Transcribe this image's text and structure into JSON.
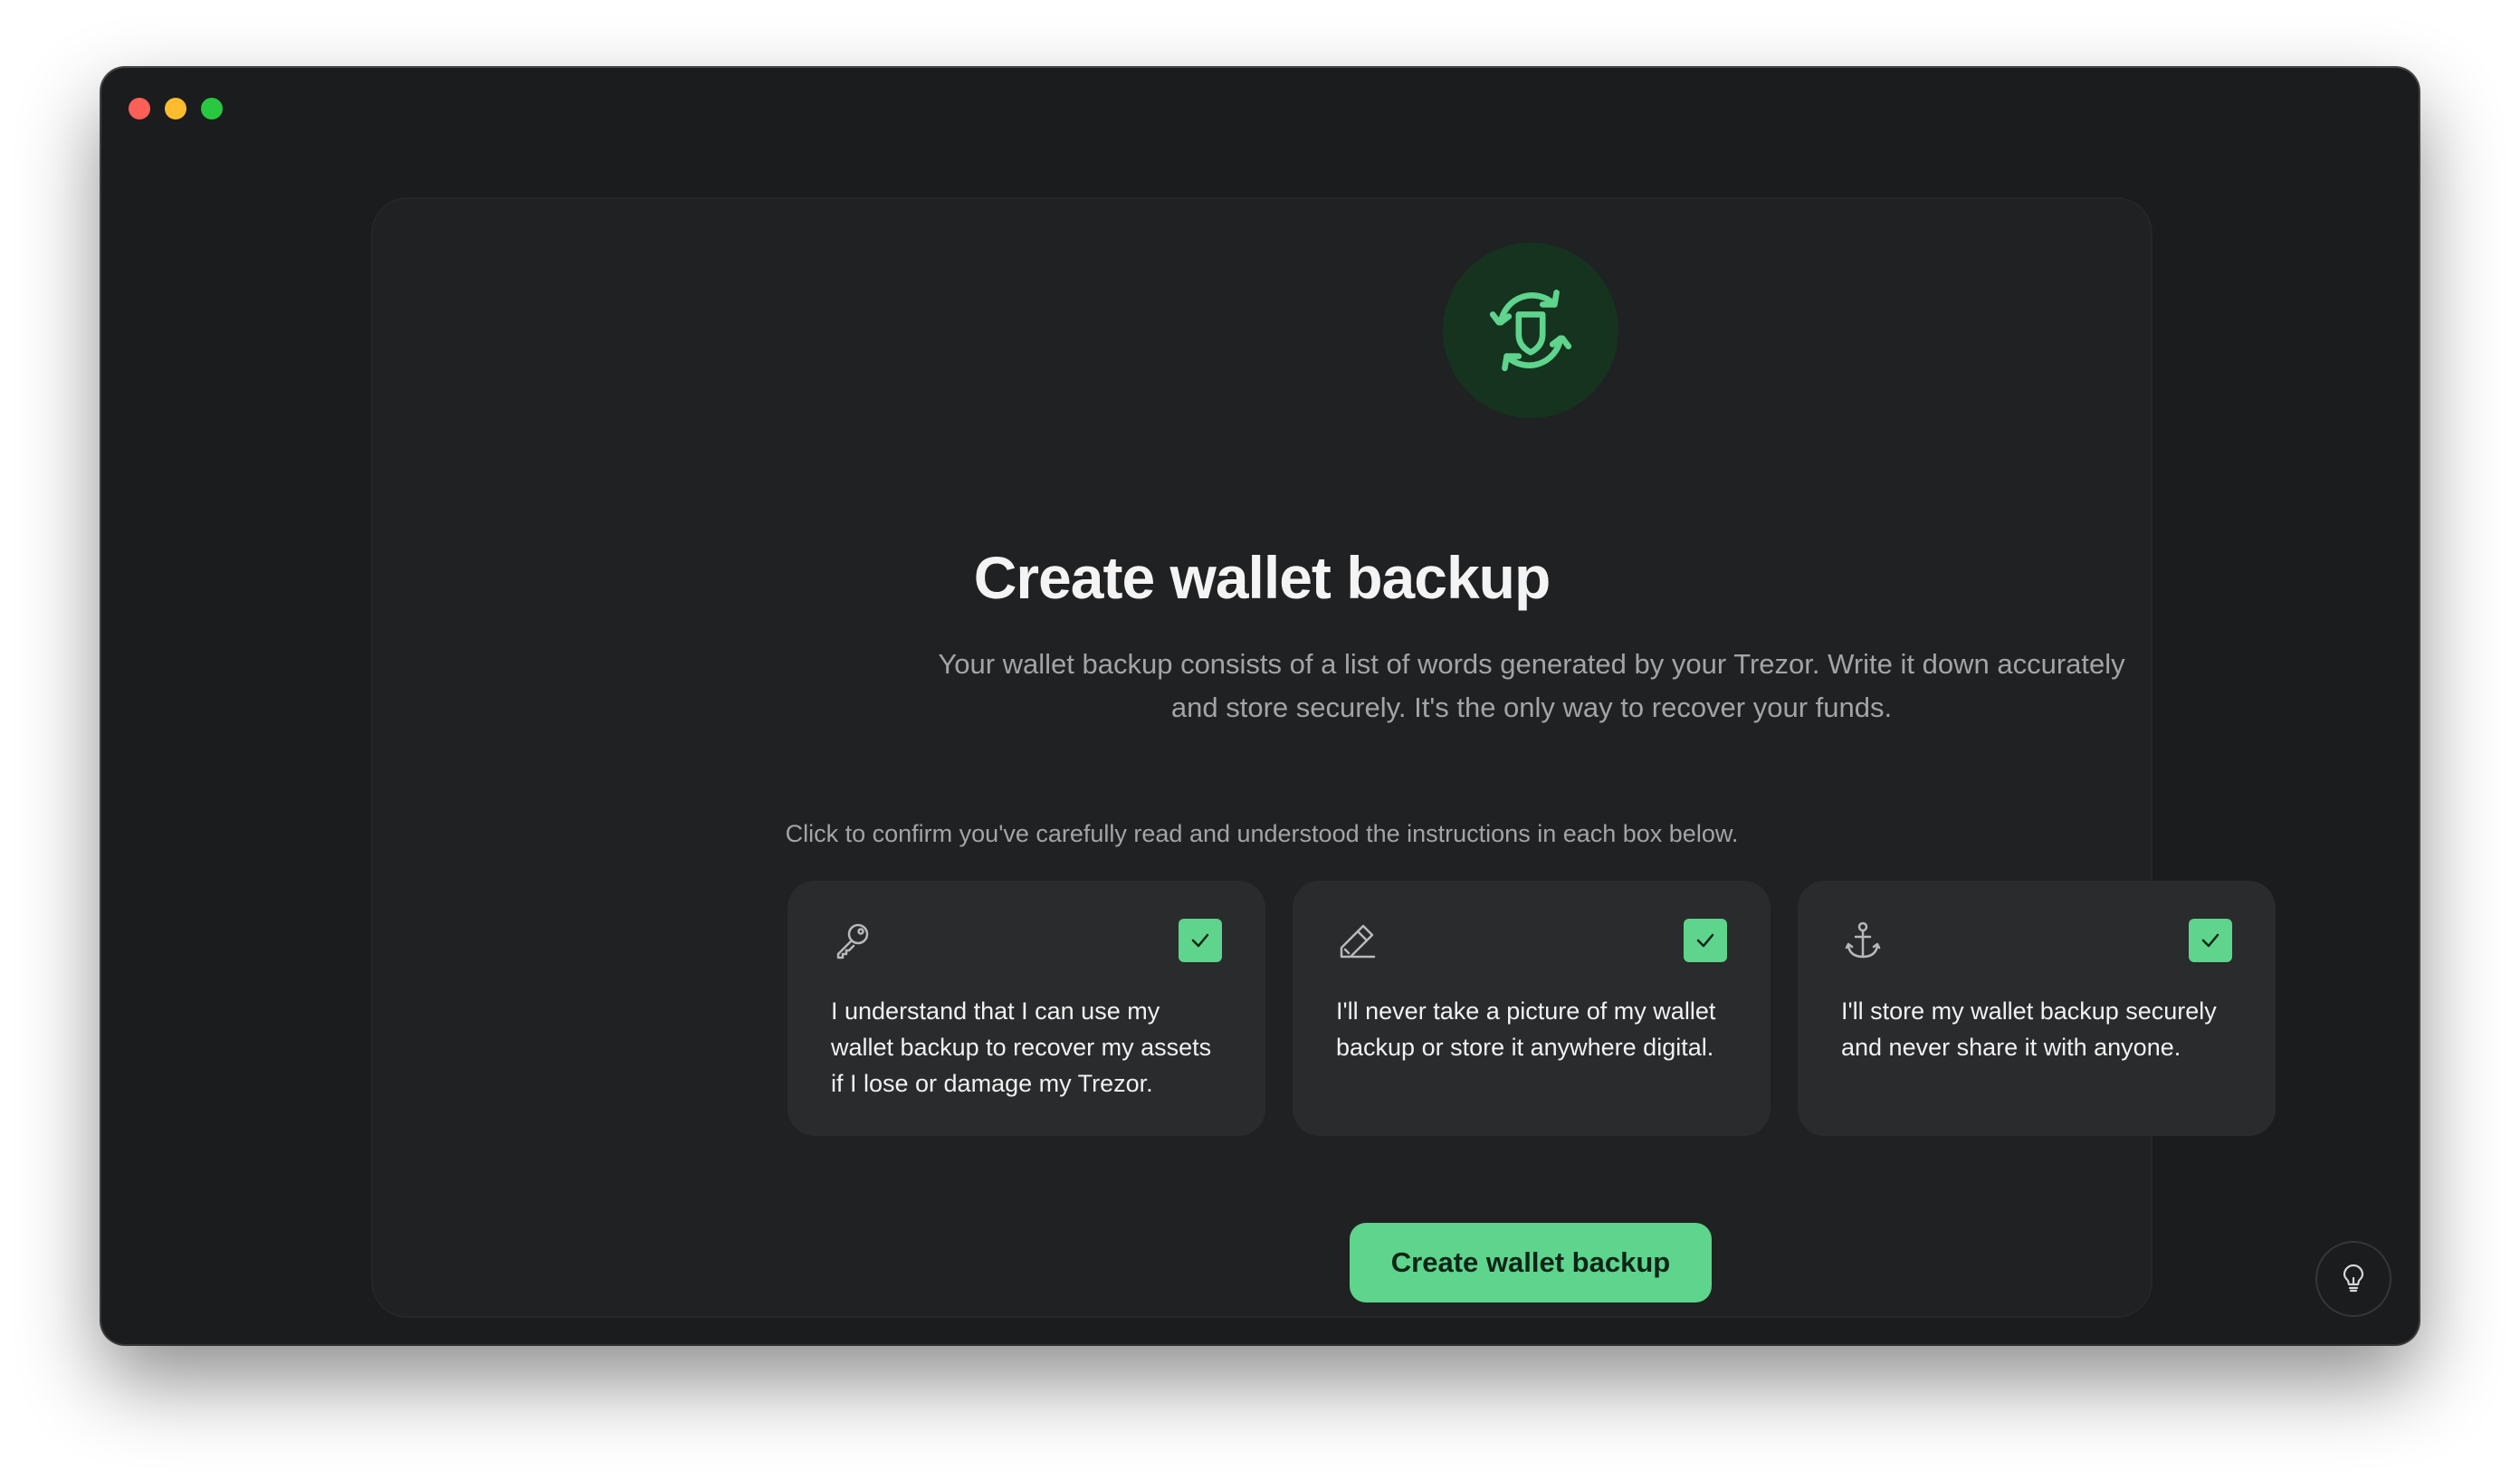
{
  "window": {
    "controls": [
      "close",
      "minimize",
      "zoom"
    ]
  },
  "header": {
    "icon": "shield-sync-icon",
    "title": "Create wallet backup",
    "subtitle_line1": "Your wallet backup consists of a list of words generated by your Trezor. Write it down accurately",
    "subtitle_line2": "and store securely. It's the only way to recover your funds."
  },
  "instruction": "Click to confirm you've carefully read and understood the instructions in each box below.",
  "boxes": [
    {
      "icon": "key-icon",
      "checked": true,
      "text": "I understand that I can use my wallet backup to recover my assets if I lose or damage my Trezor."
    },
    {
      "icon": "pencil-icon",
      "checked": true,
      "text": "I'll never take a picture of my wallet backup or store it anywhere digital."
    },
    {
      "icon": "anchor-icon",
      "checked": true,
      "text": "I'll store my wallet backup securely and never share it with anyone."
    }
  ],
  "cta": {
    "label": "Create wallet backup"
  },
  "tips": {
    "icon": "lightbulb-icon"
  },
  "colors": {
    "accent": "#5ed48c",
    "background": "#1b1c1e",
    "card": "#202123",
    "box": "#2a2b2d"
  }
}
